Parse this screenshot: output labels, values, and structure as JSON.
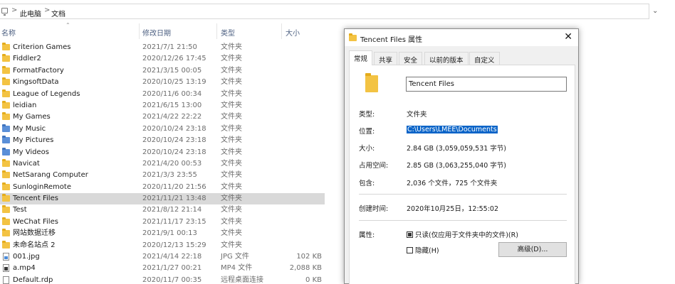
{
  "address_bar": {
    "crumbs": [
      "此电脑",
      "文档"
    ],
    "separator": ">"
  },
  "list": {
    "columns": {
      "name": "名称",
      "date": "修改日期",
      "type": "类型",
      "size": "大小"
    },
    "rows": [
      {
        "name": "Criterion Games",
        "date": "2021/7/1 21:50",
        "type": "文件夹",
        "size": "",
        "icon": "folder-icon"
      },
      {
        "name": "Fiddler2",
        "date": "2020/12/26 17:45",
        "type": "文件夹",
        "size": "",
        "icon": "folder-icon"
      },
      {
        "name": "FormatFactory",
        "date": "2021/3/15 00:05",
        "type": "文件夹",
        "size": "",
        "icon": "folder-icon"
      },
      {
        "name": "KingsoftData",
        "date": "2020/10/25 13:19",
        "type": "文件夹",
        "size": "",
        "icon": "folder-icon"
      },
      {
        "name": "League of Legends",
        "date": "2020/11/6 00:34",
        "type": "文件夹",
        "size": "",
        "icon": "folder-icon"
      },
      {
        "name": "leidian",
        "date": "2021/6/15 13:00",
        "type": "文件夹",
        "size": "",
        "icon": "folder-icon"
      },
      {
        "name": "My Games",
        "date": "2021/4/22 22:22",
        "type": "文件夹",
        "size": "",
        "icon": "folder-icon"
      },
      {
        "name": "My Music",
        "date": "2020/10/24 23:18",
        "type": "文件夹",
        "size": "",
        "icon": "music-folder-icon"
      },
      {
        "name": "My Pictures",
        "date": "2020/10/24 23:18",
        "type": "文件夹",
        "size": "",
        "icon": "pictures-folder-icon"
      },
      {
        "name": "My Videos",
        "date": "2020/10/24 23:18",
        "type": "文件夹",
        "size": "",
        "icon": "videos-folder-icon"
      },
      {
        "name": "Navicat",
        "date": "2021/4/20 00:53",
        "type": "文件夹",
        "size": "",
        "icon": "folder-icon"
      },
      {
        "name": "NetSarang Computer",
        "date": "2021/3/3 23:55",
        "type": "文件夹",
        "size": "",
        "icon": "folder-icon"
      },
      {
        "name": "SunloginRemote",
        "date": "2020/11/20 21:56",
        "type": "文件夹",
        "size": "",
        "icon": "folder-icon"
      },
      {
        "name": "Tencent Files",
        "date": "2021/11/21 13:48",
        "type": "文件夹",
        "size": "",
        "icon": "folder-icon",
        "selected": true
      },
      {
        "name": "Test",
        "date": "2021/8/12 21:14",
        "type": "文件夹",
        "size": "",
        "icon": "folder-icon"
      },
      {
        "name": "WeChat Files",
        "date": "2021/11/17 23:15",
        "type": "文件夹",
        "size": "",
        "icon": "folder-icon"
      },
      {
        "name": "网站数据迁移",
        "date": "2021/9/1 00:13",
        "type": "文件夹",
        "size": "",
        "icon": "folder-icon"
      },
      {
        "name": "未命名站点 2",
        "date": "2020/12/13 15:29",
        "type": "文件夹",
        "size": "",
        "icon": "folder-icon"
      },
      {
        "name": "001.jpg",
        "date": "2021/4/14 22:18",
        "type": "JPG 文件",
        "size": "102 KB",
        "icon": "image-file-icon"
      },
      {
        "name": "a.mp4",
        "date": "2021/1/27 00:21",
        "type": "MP4 文件",
        "size": "2,088 KB",
        "icon": "video-file-icon"
      },
      {
        "name": "Default.rdp",
        "date": "2020/11/7 00:35",
        "type": "远程桌面连接",
        "size": "0 KB",
        "icon": "rdp-file-icon"
      }
    ]
  },
  "dialog": {
    "title": "Tencent Files 属性",
    "close_glyph": "✕",
    "tabs": [
      "常规",
      "共享",
      "安全",
      "以前的版本",
      "自定义"
    ],
    "folder_name": "Tencent Files",
    "props": {
      "type_label": "类型:",
      "type_value": "文件夹",
      "location_label": "位置:",
      "location_value": "C:\\Users\\LMEE\\Documents",
      "size_label": "大小:",
      "size_value": "2.84 GB (3,059,059,531 字节)",
      "disk_label": "占用空间:",
      "disk_value": "2.85 GB (3,063,255,040 字节)",
      "contains_label": "包含:",
      "contains_value": "2,036 个文件，725 个文件夹",
      "created_label": "创建时间:",
      "created_value": "2020年10月25日，12:55:02",
      "attr_label": "属性:",
      "readonly_label": "只读(仅应用于文件夹中的文件)(R)",
      "hidden_label": "隐藏(H)",
      "advanced_button": "高级(D)..."
    }
  }
}
